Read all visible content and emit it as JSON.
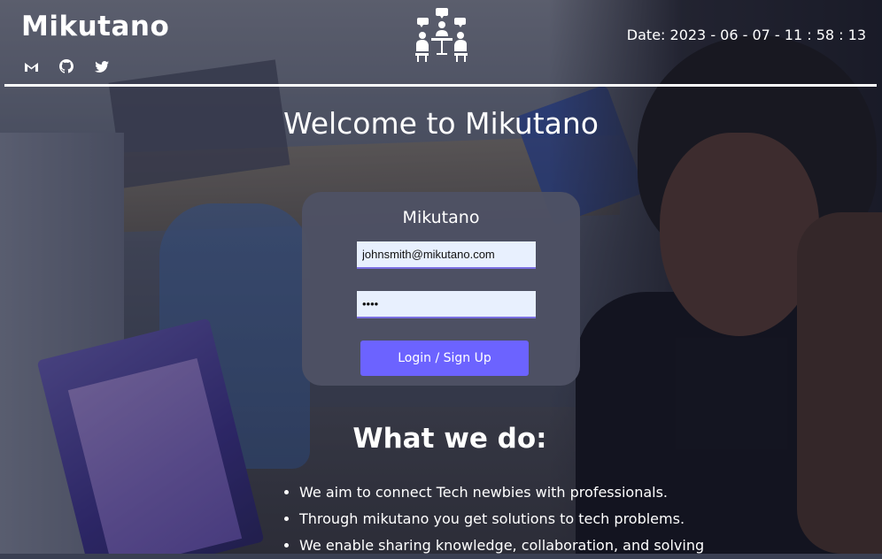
{
  "header": {
    "brand": "Mikutano",
    "datetime": "Date: 2023 - 06 - 07 - 11 : 58 : 13",
    "social": [
      {
        "icon": "gmail-icon"
      },
      {
        "icon": "github-icon"
      },
      {
        "icon": "twitter-icon"
      }
    ],
    "logo_icon": "meeting-people-icon"
  },
  "welcome": "Welcome to Mikutano",
  "login": {
    "title": "Mikutano",
    "email_value": "johnsmith@mikutano.com",
    "password_value": "••••",
    "button_label": "Login / Sign Up"
  },
  "what_we_do": {
    "title": "What we do:",
    "items": [
      "We aim to connect Tech newbies with professionals.",
      "Through mikutano you get solutions to tech problems.",
      "We enable sharing knowledge, collaboration, and solving"
    ]
  },
  "colors": {
    "accent": "#6c63ff",
    "card": "#4e5164",
    "input_bg": "#e8f0fe"
  }
}
